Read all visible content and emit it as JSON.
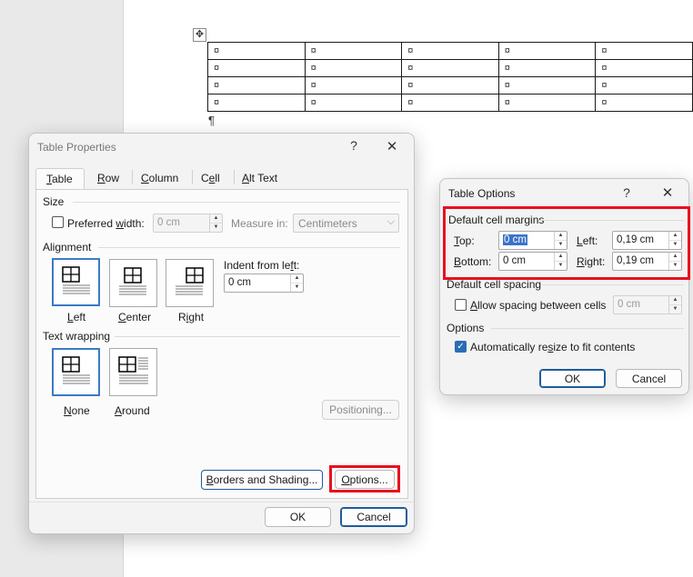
{
  "document": {
    "cell_mark": "¤",
    "paragraph_mark": "¶",
    "move_handle_icon": "move-arrows-icon",
    "rows": 4,
    "cols": 5
  },
  "table_properties": {
    "title": "Table Properties",
    "help": "?",
    "close": "✕",
    "tabs": [
      "Table",
      "Row",
      "Column",
      "Cell",
      "Alt Text"
    ],
    "active_tab": "Table",
    "size": {
      "section": "Size",
      "preferred_width_label": "Preferred width:",
      "preferred_width_value": "0 cm",
      "measure_in_label": "Measure in:",
      "measure_in_value": "Centimeters"
    },
    "alignment": {
      "section": "Alignment",
      "options": [
        "Left",
        "Center",
        "Right"
      ],
      "selected": "Left",
      "indent_label": "Indent from left:",
      "indent_value": "0 cm"
    },
    "text_wrapping": {
      "section": "Text wrapping",
      "options": [
        "None",
        "Around"
      ],
      "selected": "None",
      "positioning_button": "Positioning..."
    },
    "borders_button": "Borders and Shading...",
    "options_button": "Options...",
    "ok_button": "OK",
    "cancel_button": "Cancel"
  },
  "table_options": {
    "title": "Table Options",
    "help": "?",
    "close": "✕",
    "default_cell_margins": "Default cell margins",
    "top_label": "Top:",
    "top_value": "0 cm",
    "bottom_label": "Bottom:",
    "bottom_value": "0 cm",
    "left_label": "Left:",
    "left_value": "0,19 cm",
    "right_label": "Right:",
    "right_value": "0,19 cm",
    "default_cell_spacing": "Default cell spacing",
    "allow_spacing_label": "Allow spacing between cells",
    "allow_spacing_checked": false,
    "spacing_value": "0 cm",
    "options_section": "Options",
    "auto_resize_label": "Automatically resize to fit contents",
    "auto_resize_checked": true,
    "ok_button": "OK",
    "cancel_button": "Cancel"
  },
  "colors": {
    "highlight_red": "#e8101f",
    "accent_blue": "#2a6db5"
  }
}
